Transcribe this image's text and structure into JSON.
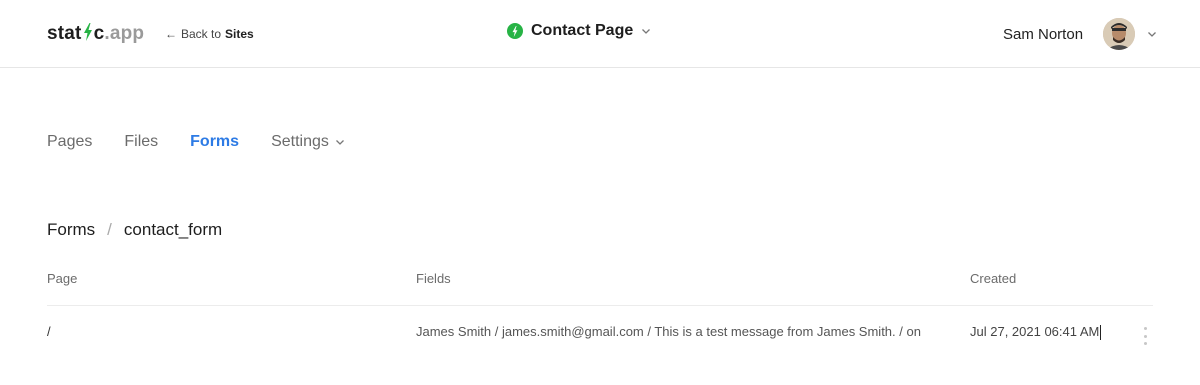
{
  "header": {
    "logo": {
      "prefix": "stat",
      "suffix": "c",
      "tld": ".app"
    },
    "back": {
      "arrow": "←",
      "text": "Back to",
      "target": "Sites"
    },
    "site": {
      "title": "Contact Page",
      "icon": "bolt-icon",
      "accent": "#27b345"
    },
    "user": {
      "name": "Sam Norton"
    }
  },
  "nav": {
    "items": [
      {
        "label": "Pages"
      },
      {
        "label": "Files"
      },
      {
        "label": "Forms",
        "active": true
      },
      {
        "label": "Settings",
        "has_dropdown": true
      }
    ],
    "active_color": "#2d7be5"
  },
  "breadcrumb": {
    "root": "Forms",
    "separator": "/",
    "current": "contact_form"
  },
  "table": {
    "columns": [
      "Page",
      "Fields",
      "Created"
    ],
    "rows": [
      {
        "page": "/",
        "fields": "James Smith / james.smith@gmail.com / This is a test message from James Smith. / on",
        "created": "Jul 27, 2021 06:41 AM"
      }
    ]
  }
}
